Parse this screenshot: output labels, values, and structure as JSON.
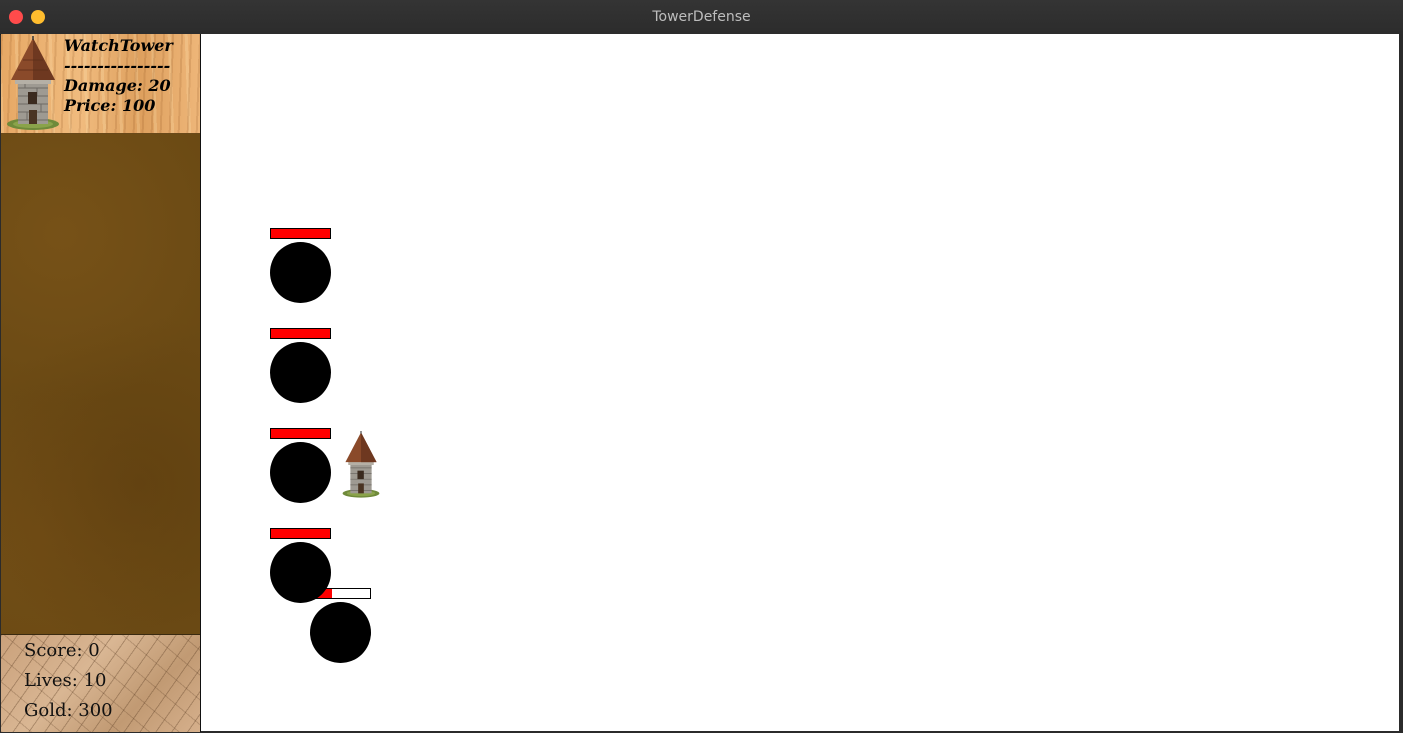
{
  "window": {
    "title": "TowerDefense"
  },
  "tower_card": {
    "name": "WatchTower",
    "separator": "----------------",
    "damage": "Damage: 20",
    "price": "Price: 100",
    "icon": "watchtower-icon"
  },
  "stats": {
    "score": "Score: 0",
    "lives": "Lives: 10",
    "gold": "Gold: 300"
  },
  "enemies": [
    {
      "health_fraction": 1.0
    },
    {
      "health_fraction": 1.0
    },
    {
      "health_fraction": 1.0
    },
    {
      "health_fraction": 1.0
    },
    {
      "health_fraction": 0.35
    }
  ],
  "placed_towers": [
    {
      "type": "WatchTower",
      "icon": "watchtower-icon"
    }
  ],
  "colors": {
    "health": "#ff0000",
    "enemy": "#000000",
    "board": "#ffffff",
    "close_button": "#ff4b4b",
    "minimize_button": "#ffbd2e"
  }
}
